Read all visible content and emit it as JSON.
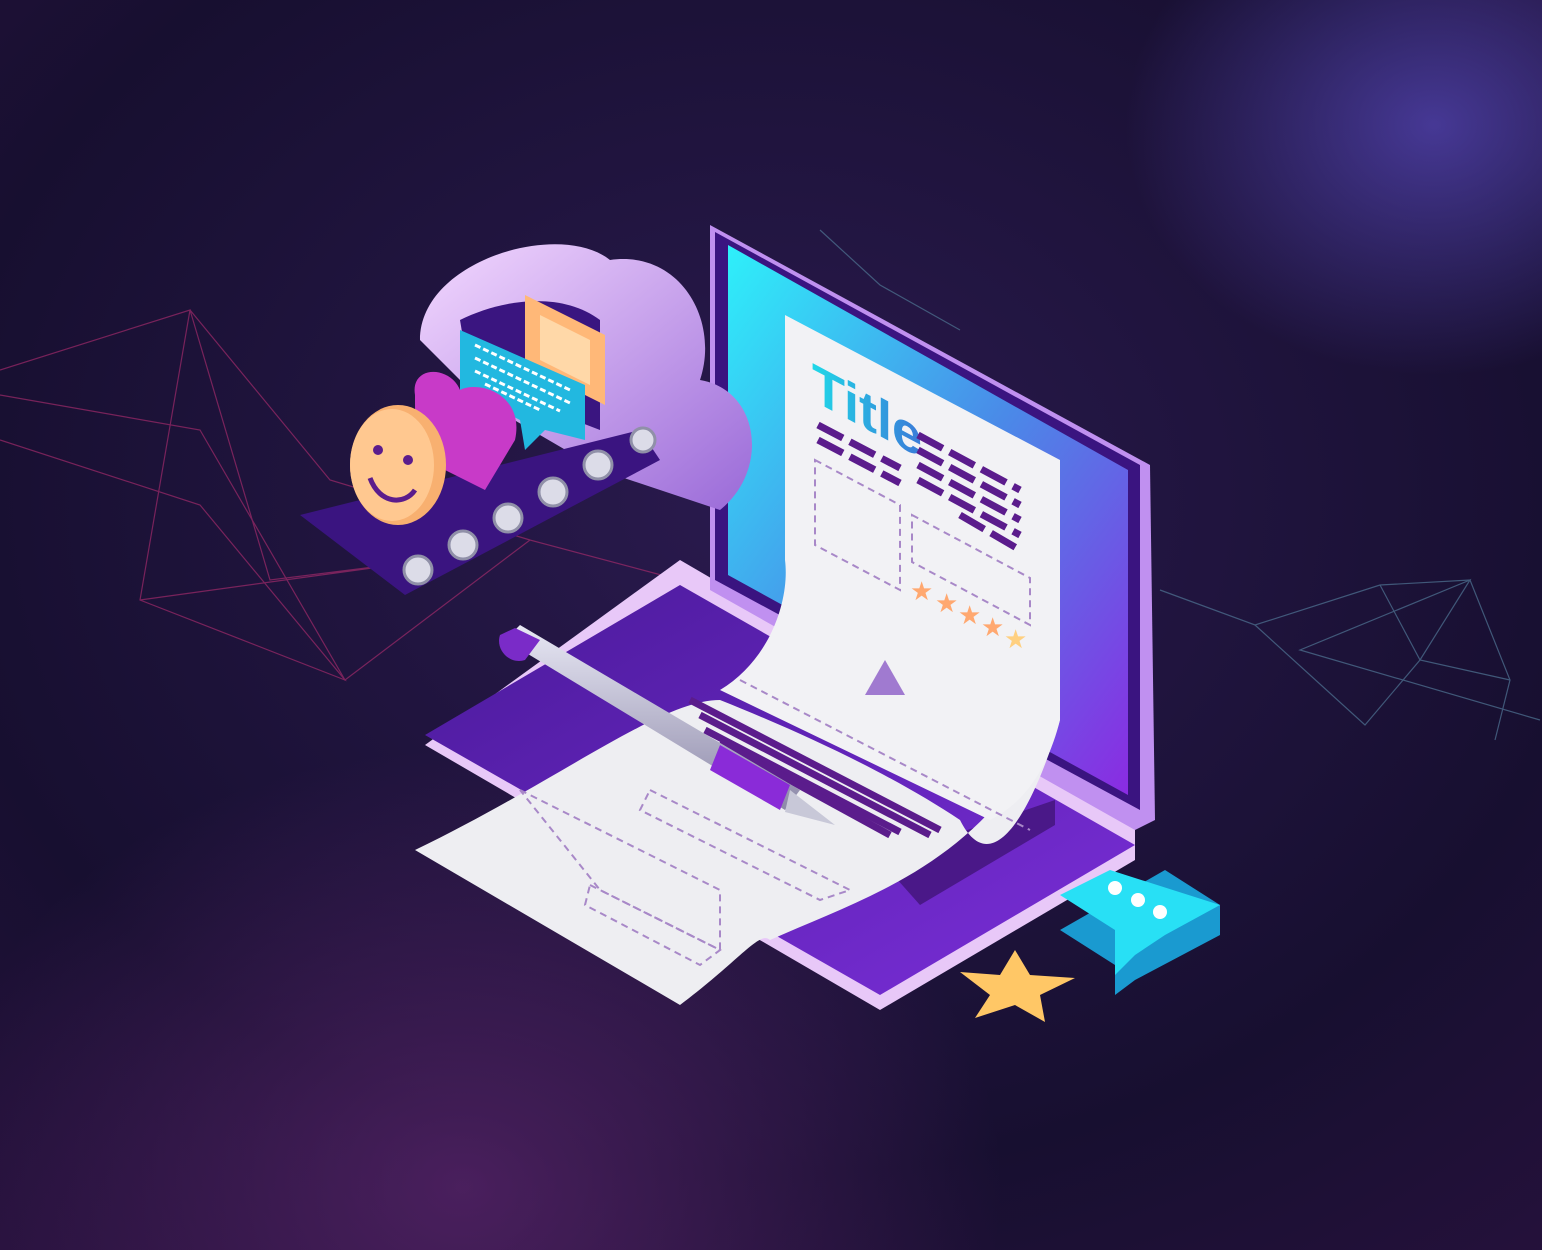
{
  "document": {
    "title": "Title",
    "rating_stars": 5
  },
  "colors": {
    "background_top": "#150f2e",
    "background_bottom": "#3a1a4a",
    "laptop": "#6a2bc9",
    "screen_top": "#2ee6f5",
    "screen_bottom": "#8a2be2",
    "paper": "#efeff2",
    "accent_purple": "#5b1c8c",
    "accent_cyan": "#22c7e8",
    "star": "#ffc766"
  },
  "icons": [
    "smiley-icon",
    "heart-icon",
    "chat-message-icon",
    "image-icon",
    "pen-icon",
    "chat-bubble-icon",
    "star-icon",
    "cloud-icon",
    "conveyor-belt-icon"
  ]
}
